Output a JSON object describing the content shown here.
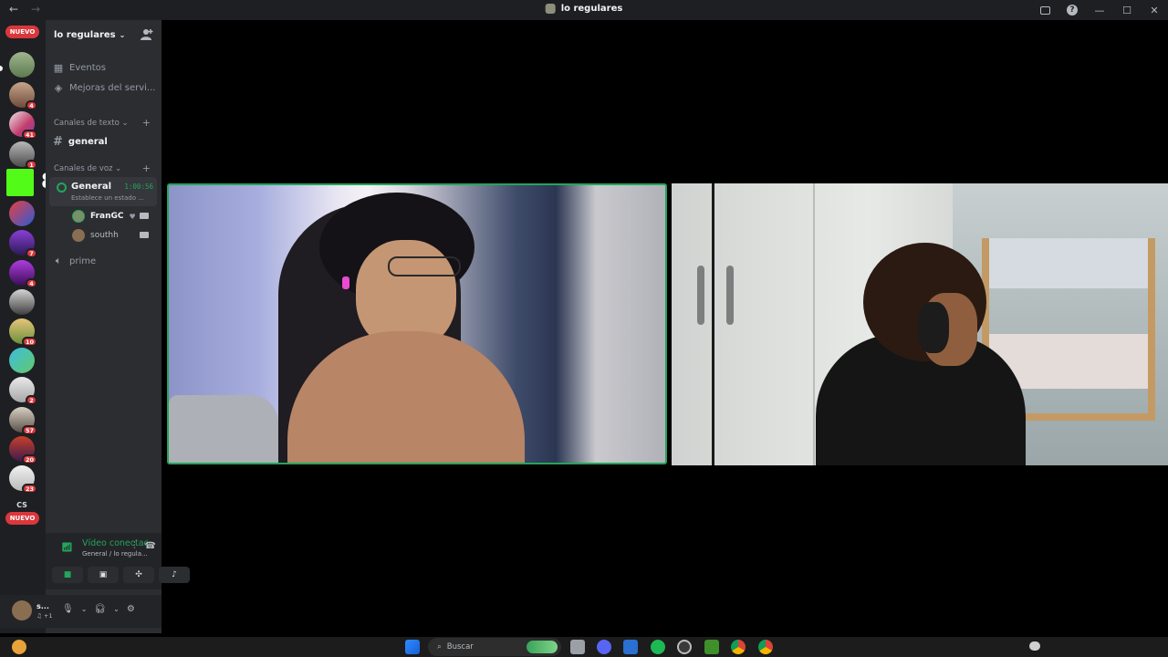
{
  "window": {
    "title": "lo regulares"
  },
  "rail": {
    "nuevo_top": "NUEVO",
    "nuevo_bottom": "NUEVO",
    "cs_label": "CS",
    "badges": [
      "1",
      "4",
      "41",
      "1",
      "7",
      "4",
      "10",
      "2",
      "57",
      "20",
      "23"
    ]
  },
  "server": {
    "name": "lo regulares",
    "events": "Eventos",
    "boosts": "Mejoras del servi...",
    "text_category": "Canales de texto",
    "text_channel": "general",
    "voice_category": "Canales de voz",
    "voice_channel": "General",
    "voice_timer": "1:00:56",
    "voice_status": "Establece un estado ...",
    "voice_users": [
      "FranGC",
      "southh"
    ],
    "other_voice_channel": "prime"
  },
  "voice_panel": {
    "title": "Vídeo conectado",
    "subtitle": "General / lo regula..."
  },
  "user_panel": {
    "name": "s...",
    "sub": "♫ +1"
  },
  "taskbar": {
    "search_placeholder": "Buscar"
  },
  "colors": {
    "accent": "#23a55a",
    "danger": "#da373c",
    "bg": "#1e1f22",
    "sidebar": "#2b2d31"
  }
}
